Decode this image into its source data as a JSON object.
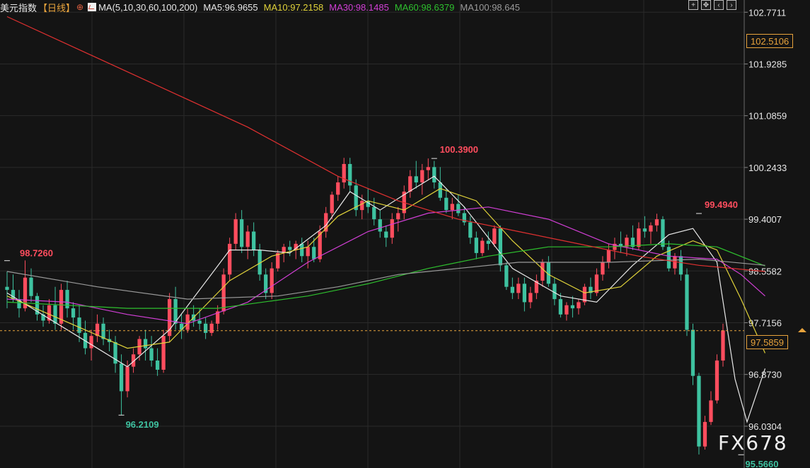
{
  "header": {
    "symbol": "美元指数",
    "period": "【日线】",
    "ma_params": "MA(5,10,30,60,100,200)",
    "ma_values": [
      {
        "label": "MA5:96.9655",
        "color": "#e8e8e8"
      },
      {
        "label": "MA10:97.2158",
        "color": "#e0d23a"
      },
      {
        "label": "MA30:98.1485",
        "color": "#d23fd6"
      },
      {
        "label": "MA60:98.6379",
        "color": "#2ec02e"
      },
      {
        "label": "MA100:98.645",
        "color": "#9a9a9a"
      }
    ]
  },
  "toolbar": {
    "icons": [
      "crosshair-icon",
      "move-icon",
      "zoom-out-icon",
      "zoom-in-icon"
    ]
  },
  "current_price": "97.5859",
  "crosshair_price": "102.5106",
  "watermark": "FX678",
  "colors": {
    "up": "#ff4d5e",
    "down": "#3ec2a0",
    "background": "#141414",
    "grid": "#2a2a2a",
    "axis_text": "#e8e8e8",
    "current_line": "#e8a33c"
  },
  "chart_data": {
    "type": "candlestick",
    "y_axis_ticks": [
      "102.7711",
      "101.9285",
      "101.0859",
      "100.2433",
      "99.4007",
      "98.5582",
      "97.7156",
      "96.8730",
      "96.0304"
    ],
    "ylim": [
      95.35,
      102.97
    ],
    "annotations": [
      {
        "text": "98.7260",
        "index": 0,
        "value": 98.726,
        "kind": "high"
      },
      {
        "text": "96.2109",
        "index": 19,
        "value": 96.2109,
        "kind": "low"
      },
      {
        "text": "100.3900",
        "index": 71,
        "value": 100.39,
        "kind": "high"
      },
      {
        "text": "99.4940",
        "index": 115,
        "value": 99.494,
        "kind": "high"
      },
      {
        "text": "95.5660",
        "index": 122,
        "value": 95.566,
        "kind": "low"
      }
    ],
    "candles": [
      [
        98.3,
        98.55,
        97.95,
        98.25
      ],
      [
        98.25,
        98.5,
        98.05,
        98.1
      ],
      [
        98.1,
        98.25,
        97.8,
        97.95
      ],
      [
        97.95,
        98.73,
        97.9,
        98.45
      ],
      [
        98.45,
        98.6,
        98.05,
        98.15
      ],
      [
        98.15,
        98.2,
        97.75,
        97.85
      ],
      [
        97.85,
        98.0,
        97.65,
        97.75
      ],
      [
        97.75,
        98.1,
        97.7,
        98.0
      ],
      [
        98.0,
        98.3,
        97.6,
        97.7
      ],
      [
        97.7,
        98.35,
        97.6,
        98.25
      ],
      [
        98.25,
        98.4,
        97.8,
        97.95
      ],
      [
        97.95,
        98.05,
        97.6,
        97.8
      ],
      [
        97.8,
        98.0,
        97.4,
        97.55
      ],
      [
        97.55,
        97.75,
        97.2,
        97.3
      ],
      [
        97.3,
        97.6,
        97.1,
        97.5
      ],
      [
        97.5,
        97.85,
        97.4,
        97.7
      ],
      [
        97.7,
        97.8,
        97.35,
        97.45
      ],
      [
        97.45,
        97.6,
        97.25,
        97.4
      ],
      [
        97.4,
        97.5,
        96.9,
        97.05
      ],
      [
        97.05,
        97.2,
        96.21,
        96.6
      ],
      [
        96.6,
        97.1,
        96.5,
        97.0
      ],
      [
        97.0,
        97.3,
        96.9,
        97.2
      ],
      [
        97.2,
        97.5,
        97.1,
        97.45
      ],
      [
        97.45,
        97.6,
        97.1,
        97.3
      ],
      [
        97.3,
        97.5,
        97.0,
        97.1
      ],
      [
        97.1,
        97.3,
        96.85,
        96.95
      ],
      [
        96.95,
        97.6,
        96.9,
        97.5
      ],
      [
        97.5,
        98.2,
        97.4,
        98.1
      ],
      [
        98.1,
        98.3,
        97.6,
        97.7
      ],
      [
        97.7,
        97.85,
        97.45,
        97.6
      ],
      [
        97.6,
        97.95,
        97.55,
        97.85
      ],
      [
        97.85,
        98.0,
        97.65,
        97.75
      ],
      [
        97.75,
        97.95,
        97.6,
        97.7
      ],
      [
        97.7,
        97.8,
        97.45,
        97.55
      ],
      [
        97.55,
        97.75,
        97.5,
        97.7
      ],
      [
        97.7,
        98.0,
        97.6,
        97.9
      ],
      [
        97.9,
        98.6,
        97.85,
        98.5
      ],
      [
        98.5,
        99.1,
        98.4,
        99.0
      ],
      [
        99.0,
        99.5,
        98.9,
        99.4
      ],
      [
        99.4,
        99.55,
        98.85,
        98.95
      ],
      [
        98.95,
        99.3,
        98.75,
        99.2
      ],
      [
        99.2,
        99.35,
        98.8,
        98.9
      ],
      [
        98.9,
        99.0,
        98.4,
        98.5
      ],
      [
        98.5,
        98.6,
        98.1,
        98.2
      ],
      [
        98.2,
        98.7,
        98.1,
        98.6
      ],
      [
        98.6,
        98.9,
        98.55,
        98.85
      ],
      [
        98.85,
        99.0,
        98.7,
        98.95
      ],
      [
        98.95,
        99.05,
        98.8,
        98.9
      ],
      [
        98.9,
        99.05,
        98.75,
        99.0
      ],
      [
        99.0,
        99.1,
        98.7,
        98.8
      ],
      [
        98.8,
        99.05,
        98.6,
        98.95
      ],
      [
        98.95,
        99.1,
        98.7,
        98.75
      ],
      [
        98.75,
        99.3,
        98.7,
        99.2
      ],
      [
        99.2,
        99.6,
        99.1,
        99.5
      ],
      [
        99.5,
        99.85,
        99.4,
        99.8
      ],
      [
        99.8,
        100.1,
        99.7,
        100.0
      ],
      [
        100.0,
        100.4,
        99.9,
        100.3
      ],
      [
        100.3,
        100.4,
        99.85,
        99.95
      ],
      [
        99.95,
        100.05,
        99.45,
        99.55
      ],
      [
        99.55,
        99.8,
        99.4,
        99.7
      ],
      [
        99.7,
        99.9,
        99.5,
        99.6
      ],
      [
        99.6,
        99.75,
        99.3,
        99.4
      ],
      [
        99.4,
        99.55,
        99.1,
        99.2
      ],
      [
        99.2,
        99.3,
        98.95,
        99.1
      ],
      [
        99.1,
        99.5,
        99.0,
        99.4
      ],
      [
        99.4,
        99.6,
        99.2,
        99.5
      ],
      [
        99.5,
        99.95,
        99.4,
        99.85
      ],
      [
        99.85,
        100.2,
        99.75,
        100.1
      ],
      [
        100.1,
        100.35,
        99.9,
        100.0
      ],
      [
        100.0,
        100.3,
        99.8,
        100.2
      ],
      [
        100.2,
        100.39,
        100.05,
        100.25
      ],
      [
        100.25,
        100.35,
        99.9,
        100.0
      ],
      [
        100.0,
        100.25,
        99.7,
        99.75
      ],
      [
        99.75,
        99.9,
        99.5,
        99.55
      ],
      [
        99.55,
        99.75,
        99.4,
        99.65
      ],
      [
        99.65,
        99.8,
        99.45,
        99.5
      ],
      [
        99.5,
        99.6,
        99.3,
        99.35
      ],
      [
        99.35,
        99.45,
        99.0,
        99.1
      ],
      [
        99.1,
        99.2,
        98.75,
        98.85
      ],
      [
        98.85,
        99.1,
        98.8,
        99.05
      ],
      [
        99.05,
        99.2,
        98.9,
        99.0
      ],
      [
        99.0,
        99.3,
        98.95,
        99.25
      ],
      [
        99.25,
        99.3,
        98.55,
        98.65
      ],
      [
        98.65,
        98.7,
        98.25,
        98.3
      ],
      [
        98.3,
        98.45,
        98.1,
        98.2
      ],
      [
        98.2,
        98.45,
        98.1,
        98.35
      ],
      [
        98.35,
        98.45,
        97.9,
        98.05
      ],
      [
        98.05,
        98.3,
        97.95,
        98.2
      ],
      [
        98.2,
        98.5,
        98.1,
        98.4
      ],
      [
        98.4,
        98.75,
        98.3,
        98.7
      ],
      [
        98.7,
        98.8,
        98.3,
        98.35
      ],
      [
        98.35,
        98.45,
        98.0,
        98.1
      ],
      [
        98.1,
        98.2,
        97.8,
        97.85
      ],
      [
        97.85,
        98.05,
        97.75,
        98.0
      ],
      [
        98.0,
        98.15,
        97.8,
        97.95
      ],
      [
        97.95,
        98.1,
        97.85,
        98.05
      ],
      [
        98.05,
        98.35,
        98.0,
        98.3
      ],
      [
        98.3,
        98.45,
        98.1,
        98.2
      ],
      [
        98.2,
        98.6,
        98.15,
        98.5
      ],
      [
        98.5,
        98.8,
        98.4,
        98.7
      ],
      [
        98.7,
        99.0,
        98.6,
        98.9
      ],
      [
        98.9,
        99.1,
        98.75,
        99.0
      ],
      [
        99.0,
        99.2,
        98.85,
        98.95
      ],
      [
        98.95,
        99.15,
        98.8,
        99.1
      ],
      [
        99.1,
        99.3,
        98.9,
        98.95
      ],
      [
        98.95,
        99.35,
        98.9,
        99.25
      ],
      [
        99.25,
        99.45,
        99.1,
        99.2
      ],
      [
        99.2,
        99.35,
        99.0,
        99.3
      ],
      [
        99.3,
        99.49,
        99.2,
        99.4
      ],
      [
        99.4,
        99.45,
        98.9,
        98.95
      ],
      [
        98.95,
        99.05,
        98.55,
        98.6
      ],
      [
        98.6,
        98.85,
        98.5,
        98.8
      ],
      [
        98.8,
        98.9,
        98.4,
        98.5
      ],
      [
        98.5,
        98.6,
        97.5,
        97.6
      ],
      [
        97.6,
        97.7,
        96.7,
        96.85
      ],
      [
        96.85,
        96.9,
        95.57,
        95.7
      ],
      [
        95.7,
        96.2,
        95.65,
        96.1
      ],
      [
        96.1,
        96.6,
        96.05,
        96.45
      ],
      [
        96.45,
        97.2,
        96.4,
        97.1
      ],
      [
        97.1,
        97.7,
        97.0,
        97.59
      ]
    ],
    "series": [
      {
        "name": "MA5",
        "color": "#e8e8e8",
        "points": [
          [
            0,
            98.2
          ],
          [
            20,
            97.0
          ],
          [
            27,
            97.6
          ],
          [
            37,
            98.9
          ],
          [
            42,
            98.9
          ],
          [
            47,
            98.85
          ],
          [
            53,
            99.3
          ],
          [
            57,
            99.85
          ],
          [
            62,
            99.55
          ],
          [
            66,
            99.8
          ],
          [
            71,
            100.1
          ],
          [
            76,
            99.6
          ],
          [
            80,
            99.1
          ],
          [
            84,
            98.6
          ],
          [
            92,
            98.15
          ],
          [
            98,
            98.05
          ],
          [
            104,
            98.65
          ],
          [
            110,
            99.15
          ],
          [
            114,
            99.25
          ],
          [
            118,
            98.7
          ],
          [
            121,
            96.8
          ],
          [
            123,
            96.1
          ],
          [
            126,
            96.97
          ]
        ]
      },
      {
        "name": "MA10",
        "color": "#e0d23a",
        "points": [
          [
            0,
            98.15
          ],
          [
            20,
            97.3
          ],
          [
            27,
            97.4
          ],
          [
            37,
            98.4
          ],
          [
            44,
            98.8
          ],
          [
            50,
            98.95
          ],
          [
            55,
            99.45
          ],
          [
            60,
            99.7
          ],
          [
            66,
            99.55
          ],
          [
            72,
            99.9
          ],
          [
            78,
            99.7
          ],
          [
            84,
            99.05
          ],
          [
            90,
            98.5
          ],
          [
            96,
            98.2
          ],
          [
            102,
            98.3
          ],
          [
            108,
            98.8
          ],
          [
            114,
            99.05
          ],
          [
            118,
            98.9
          ],
          [
            122,
            98.1
          ],
          [
            126,
            97.22
          ]
        ]
      },
      {
        "name": "MA30",
        "color": "#d23fd6",
        "points": [
          [
            0,
            98.1
          ],
          [
            10,
            98.05
          ],
          [
            20,
            97.85
          ],
          [
            30,
            97.7
          ],
          [
            40,
            98.05
          ],
          [
            50,
            98.7
          ],
          [
            60,
            99.2
          ],
          [
            70,
            99.5
          ],
          [
            80,
            99.6
          ],
          [
            90,
            99.4
          ],
          [
            100,
            99.0
          ],
          [
            110,
            98.8
          ],
          [
            118,
            98.75
          ],
          [
            122,
            98.5
          ],
          [
            126,
            98.15
          ]
        ]
      },
      {
        "name": "MA60",
        "color": "#2ec02e",
        "points": [
          [
            0,
            98.05
          ],
          [
            20,
            97.95
          ],
          [
            35,
            97.95
          ],
          [
            50,
            98.15
          ],
          [
            60,
            98.35
          ],
          [
            70,
            98.6
          ],
          [
            80,
            98.8
          ],
          [
            90,
            98.95
          ],
          [
            100,
            98.95
          ],
          [
            110,
            99.0
          ],
          [
            118,
            98.95
          ],
          [
            126,
            98.64
          ]
        ]
      },
      {
        "name": "MA100",
        "color": "#9a9a9a",
        "points": [
          [
            0,
            98.55
          ],
          [
            15,
            98.3
          ],
          [
            30,
            98.1
          ],
          [
            45,
            98.15
          ],
          [
            55,
            98.3
          ],
          [
            65,
            98.5
          ],
          [
            75,
            98.6
          ],
          [
            85,
            98.7
          ],
          [
            100,
            98.7
          ],
          [
            115,
            98.75
          ],
          [
            126,
            98.65
          ]
        ]
      },
      {
        "name": "MA200",
        "color": "#e03030",
        "points": [
          [
            0,
            102.7
          ],
          [
            20,
            101.8
          ],
          [
            40,
            100.9
          ],
          [
            55,
            100.1
          ],
          [
            65,
            99.7
          ],
          [
            75,
            99.4
          ],
          [
            85,
            99.2
          ],
          [
            95,
            99.0
          ],
          [
            105,
            98.8
          ],
          [
            115,
            98.65
          ],
          [
            126,
            98.55
          ]
        ]
      }
    ]
  }
}
